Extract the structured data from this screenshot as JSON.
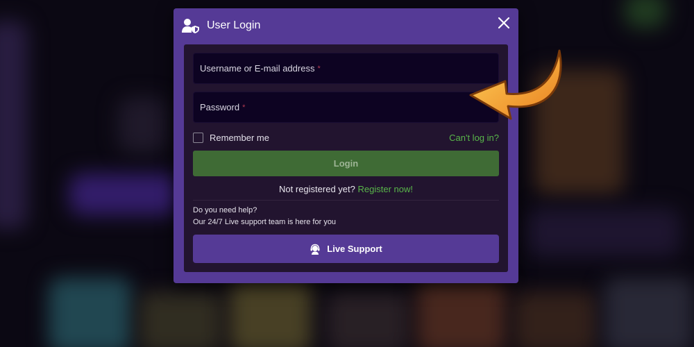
{
  "modal": {
    "title": "User Login",
    "header_icon": "user-shield-icon",
    "close_icon": "close-icon"
  },
  "form": {
    "username_placeholder": "Username or E-mail address",
    "password_placeholder": "Password",
    "required_mark": "*",
    "remember_label": "Remember me",
    "remember_checked": false,
    "forgot_link": "Can't log in?",
    "login_label": "Login"
  },
  "register": {
    "prompt": "Not registered yet?",
    "link": "Register now!"
  },
  "help": {
    "question": "Do you need help?",
    "text": "Our 24/7 Live support team is here for you",
    "support_label": "Live Support",
    "support_icon": "headset-agent-icon"
  },
  "colors": {
    "modal_bg": "#553a96",
    "body_bg": "#22142f",
    "input_bg": "#0d0322",
    "accent_green": "#59b64a",
    "login_button": "#3f6b35",
    "required": "#b43b52",
    "annotation_arrow": "#f2a23a"
  }
}
